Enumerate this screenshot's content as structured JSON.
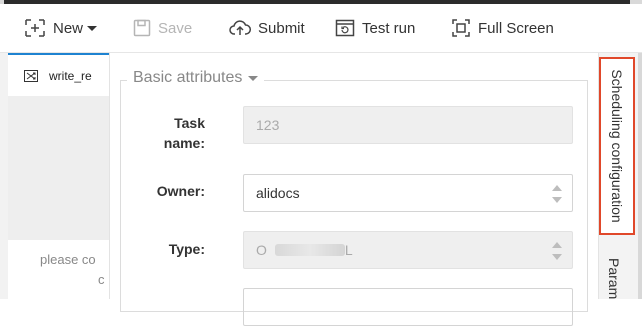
{
  "toolbar": {
    "new_label": "New",
    "save_label": "Save",
    "submit_label": "Submit",
    "test_run_label": "Test run",
    "full_screen_label": "Full Screen"
  },
  "file_tab": {
    "label": "write_re"
  },
  "left_note": {
    "line1": "please co",
    "line2": "c"
  },
  "section": {
    "title": "Basic attributes"
  },
  "fields": {
    "task_name_label_1": "Task",
    "task_name_label_2": "name:",
    "task_name_value": "123",
    "owner_label": "Owner:",
    "owner_value": "alidocs",
    "type_label": "Type:",
    "type_value_start": "O",
    "type_value_end": "L"
  },
  "right_tabs": {
    "scheduling": "Scheduling configuration",
    "params": "Param"
  },
  "colors": {
    "highlight": "#e0482a",
    "accent": "#1e83d1"
  }
}
